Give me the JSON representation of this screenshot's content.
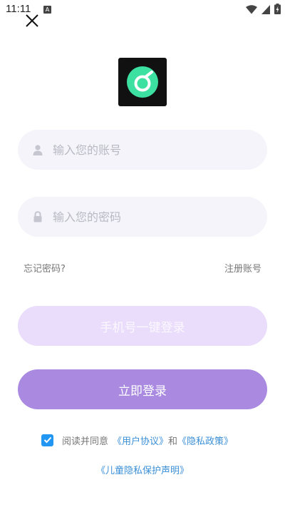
{
  "status_bar": {
    "time": "11:11",
    "badge": "A",
    "icons": [
      "wifi-icon",
      "cellular-signal-icon",
      "battery-charging-icon"
    ]
  },
  "top_bar": {
    "close_icon": "close-icon"
  },
  "logo": {
    "icon": "app-logo-icon",
    "colors": {
      "background": "#111111",
      "ring": "#3ce0a0",
      "mark": "#ffffff"
    }
  },
  "form": {
    "account": {
      "placeholder": "输入您的账号",
      "value": "",
      "icon": "user-icon"
    },
    "password": {
      "placeholder": "输入您的密码",
      "value": "",
      "icon": "lock-icon"
    },
    "forgot_password": "忘记密码?",
    "register": "注册账号"
  },
  "buttons": {
    "phone_login": "手机号一键登录",
    "login": "立即登录"
  },
  "agreement": {
    "checked": true,
    "prefix": "阅读并同意",
    "user_agreement": "《用户协议》",
    "and": "和",
    "privacy_policy": "《隐私政策》",
    "children_privacy": "《儿童隐私保护声明》"
  },
  "colors": {
    "accent": "#a98ae0",
    "accent_light": "#e9ddfb",
    "link": "#3b8fd6",
    "checkbox": "#2196f3",
    "input_bg": "#f4f4fa"
  }
}
